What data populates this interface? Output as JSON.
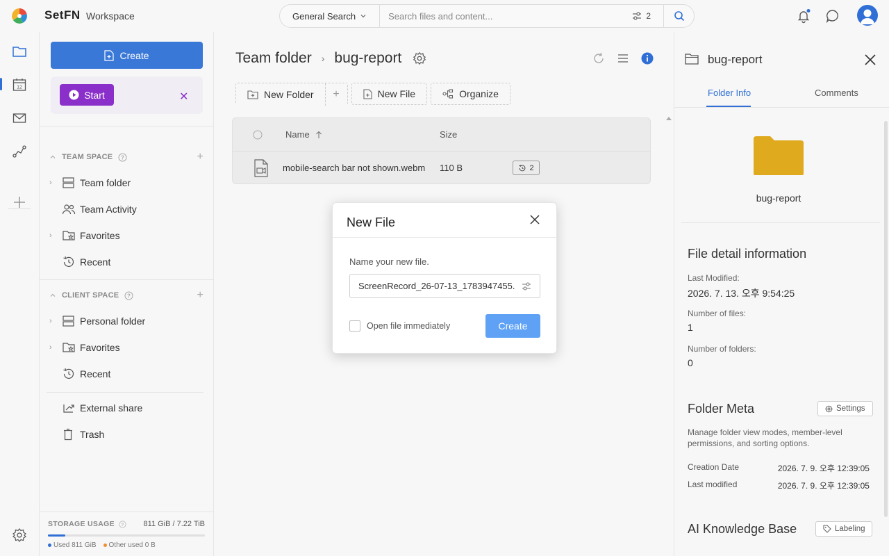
{
  "app": {
    "brand": "SetFN",
    "workspace": "Workspace"
  },
  "search": {
    "scope": "General Search",
    "placeholder": "Search files and content...",
    "filter_count": "2"
  },
  "sidebar": {
    "create_label": "Create",
    "start_label": "Start",
    "team_space_label": "TEAM SPACE",
    "team_items": [
      {
        "label": "Team folder"
      },
      {
        "label": "Team Activity"
      },
      {
        "label": "Favorites"
      },
      {
        "label": "Recent"
      }
    ],
    "client_space_label": "CLIENT SPACE",
    "client_items": [
      {
        "label": "Personal folder"
      },
      {
        "label": "Favorites"
      },
      {
        "label": "Recent"
      }
    ],
    "extra_items": [
      {
        "label": "External share"
      },
      {
        "label": "Trash"
      }
    ],
    "storage": {
      "label": "STORAGE USAGE",
      "value": "811 GiB / 7.22 TiB",
      "used": "Used 811 GiB",
      "other": "Other used 0 B",
      "fraction": 0.11
    }
  },
  "main": {
    "breadcrumb": [
      "Team folder",
      "bug-report"
    ],
    "toolbar": {
      "new_folder": "New Folder",
      "new_file": "New File",
      "organize": "Organize"
    },
    "table": {
      "columns": {
        "name": "Name",
        "size": "Size"
      },
      "rows": [
        {
          "name": "mobile-search bar not shown.webm",
          "size": "110 B",
          "versions": "2"
        }
      ]
    }
  },
  "dialog": {
    "title": "New File",
    "label": "Name your new file.",
    "value": "ScreenRecord_26-07-13_1783947455.",
    "open_immediately": "Open file immediately",
    "create": "Create"
  },
  "right_panel": {
    "title": "bug-report",
    "tabs": [
      "Folder Info",
      "Comments"
    ],
    "folder_name": "bug-report",
    "detail_heading": "File detail information",
    "last_modified_label": "Last Modified:",
    "last_modified_value": "2026. 7. 13. 오후 9:54:25",
    "num_files_label": "Number of files:",
    "num_files_value": "1",
    "num_folders_label": "Number of folders:",
    "num_folders_value": "0",
    "meta_heading": "Folder Meta",
    "settings_label": "Settings",
    "meta_desc": "Manage folder view modes, member-level permissions, and sorting options.",
    "creation_date_label": "Creation Date",
    "creation_date_value": "2026. 7. 9. 오후 12:39:05",
    "last_mod_label": "Last modified",
    "last_mod_value": "2026. 7. 9. 오후 12:39:05",
    "ai_heading": "AI Knowledge Base",
    "labeling_label": "Labeling"
  },
  "colors": {
    "accent": "#2f6fd6",
    "start": "#8a2fc9",
    "folder": "#e0aa1e",
    "create_btn": "#5fa2f5"
  }
}
